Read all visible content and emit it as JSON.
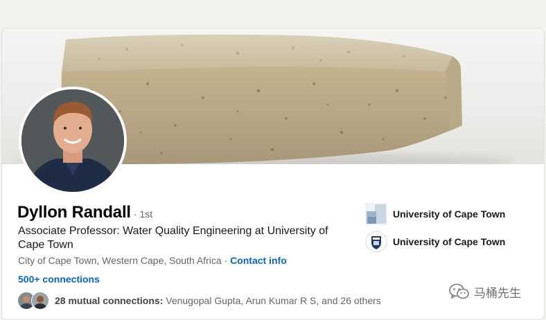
{
  "profile": {
    "name": "Dyllon Randall",
    "degree": "· 1st",
    "headline": "Associate Professor: Water Quality Engineering at University of Cape Town",
    "location": "City of Cape Town, Western Cape, South Africa",
    "separator": " · ",
    "contact_info": "Contact info",
    "connections": "500+ connections",
    "mutual_bold": "28 mutual connections:",
    "mutual_names": " Venugopal Gupta, Arun Kumar R S, and 26 others"
  },
  "orgs": [
    {
      "name": "University of Cape Town",
      "icon": "building-logo-icon"
    },
    {
      "name": "University of Cape Town",
      "icon": "uct-crest-icon"
    }
  ],
  "banner": {
    "subject": "brick-icon"
  },
  "watermark": {
    "text": "马桶先生",
    "icon": "wechat-icon"
  },
  "colors": {
    "link": "#0a66c2",
    "text_primary": "#000000",
    "text_secondary": "#666666",
    "page_bg": "#f3f2ef"
  }
}
